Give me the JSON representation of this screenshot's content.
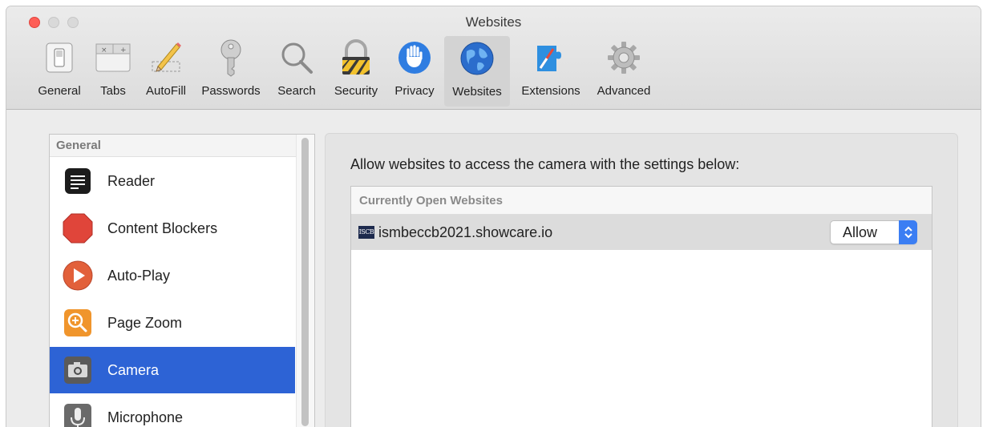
{
  "window": {
    "title": "Websites"
  },
  "toolbar": {
    "items": [
      {
        "label": "General",
        "icon": "general-switch-icon"
      },
      {
        "label": "Tabs",
        "icon": "tabs-icon"
      },
      {
        "label": "AutoFill",
        "icon": "pencil-icon"
      },
      {
        "label": "Passwords",
        "icon": "key-icon"
      },
      {
        "label": "Search",
        "icon": "magnifier-icon"
      },
      {
        "label": "Security",
        "icon": "lock-icon"
      },
      {
        "label": "Privacy",
        "icon": "hand-icon"
      },
      {
        "label": "Websites",
        "icon": "globe-icon",
        "selected": true
      },
      {
        "label": "Extensions",
        "icon": "puzzle-compass-icon"
      },
      {
        "label": "Advanced",
        "icon": "gear-icon"
      }
    ]
  },
  "sidebar": {
    "header": "General",
    "items": [
      {
        "label": "Reader",
        "icon": "reader-icon"
      },
      {
        "label": "Content Blockers",
        "icon": "stop-sign-icon"
      },
      {
        "label": "Auto-Play",
        "icon": "play-icon"
      },
      {
        "label": "Page Zoom",
        "icon": "zoom-icon"
      },
      {
        "label": "Camera",
        "icon": "camera-icon",
        "selected": true
      },
      {
        "label": "Microphone",
        "icon": "microphone-icon"
      }
    ]
  },
  "main": {
    "description": "Allow websites to access the camera with the settings below:",
    "table": {
      "header": "Currently Open Websites",
      "rows": [
        {
          "favicon_text": "ISCB",
          "site": "ismbeccb2021.showcare.io",
          "permission": "Allow"
        }
      ]
    }
  },
  "colors": {
    "selection": "#2d63d5",
    "select_button": "#3b7ef3",
    "close_button": "#fe5f57"
  }
}
